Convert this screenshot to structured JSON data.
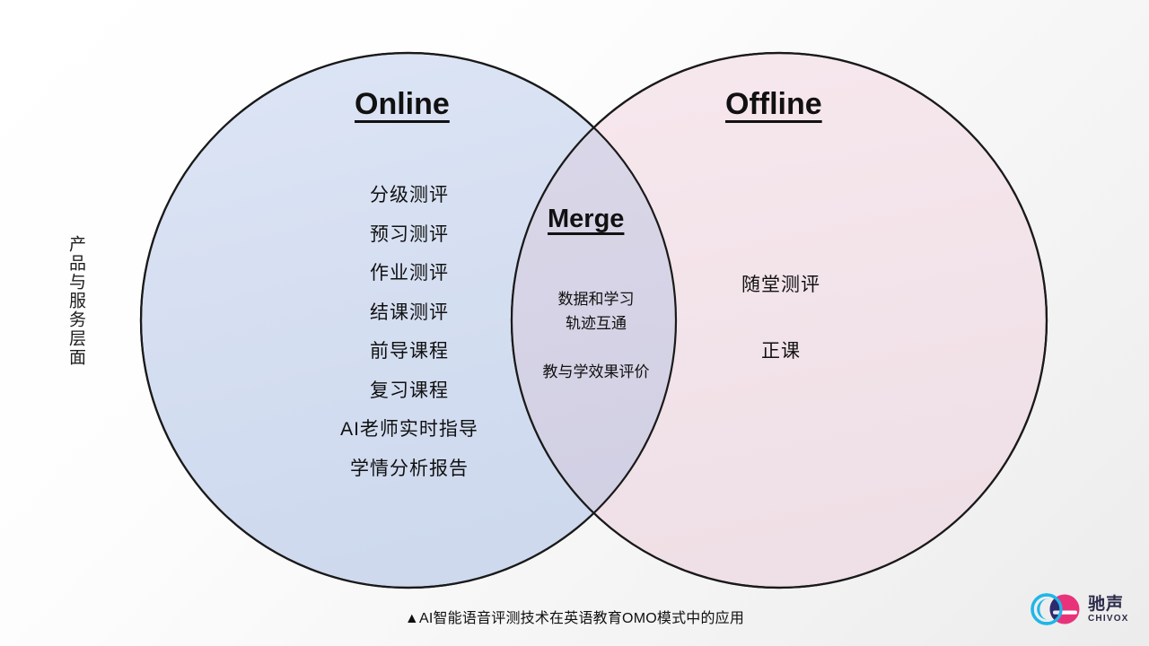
{
  "diagram": {
    "type": "venn",
    "side_label": "产品与服务层面",
    "caption": "▲AI智能语音评测技术在英语教育OMO模式中的应用",
    "colors": {
      "left_circle_fill": "#d7e0f2",
      "right_circle_fill": "#f4e4ea",
      "overlap_fill": "#d5d3e6",
      "stroke": "#1a1a1a",
      "text": "#101010",
      "background_start": "#ffffff",
      "background_end": "#ececec"
    },
    "left": {
      "heading": "Online",
      "items": [
        "分级测评",
        "预习测评",
        "作业测评",
        "结课测评",
        "前导课程",
        "复习课程",
        "AI老师实时指导",
        "学情分析报告"
      ]
    },
    "overlap": {
      "heading": "Merge",
      "items": [
        "数据和学习",
        "轨迹互通",
        "教与学效果评价"
      ]
    },
    "right": {
      "heading": "Offline",
      "items": [
        "随堂测评",
        "正课"
      ]
    }
  },
  "logo": {
    "name_cn": "驰声",
    "name_en": "CHIVOX",
    "mark_colors": {
      "left_ring": "#21b6e8",
      "right_circle": "#e8337a",
      "overlap": "#2b2b6e"
    }
  }
}
